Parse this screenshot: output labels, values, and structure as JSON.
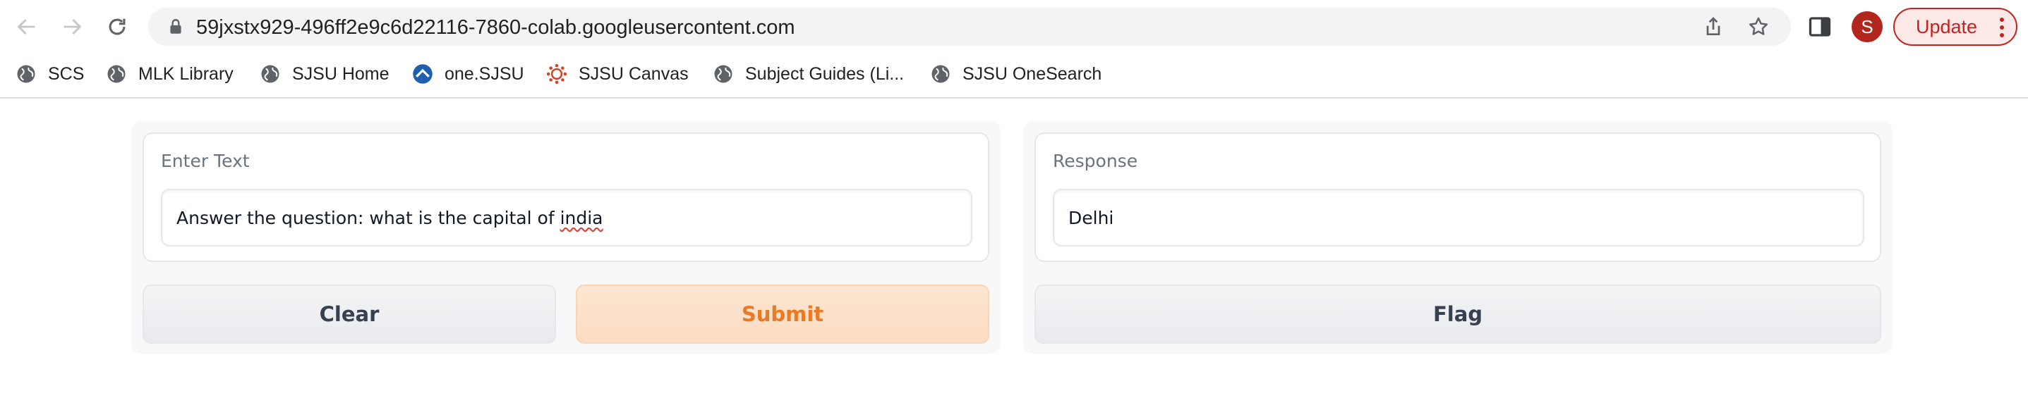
{
  "browser": {
    "url": "59jxstx929-496ff2e9c6d22116-7860-colab.googleusercontent.com",
    "profile_initial": "S",
    "update_label": "Update",
    "colors": {
      "update_accent": "#c5221f",
      "avatar": "#b3261e"
    }
  },
  "bookmarks": [
    {
      "label": "SCS",
      "icon": "globe-icon"
    },
    {
      "label": "MLK Library",
      "icon": "globe-icon"
    },
    {
      "label": "SJSU Home",
      "icon": "globe-icon"
    },
    {
      "label": "one.SJSU",
      "icon": "one-sjsu-icon"
    },
    {
      "label": "SJSU Canvas",
      "icon": "canvas-icon"
    },
    {
      "label": "Subject Guides (Li...",
      "icon": "globe-icon"
    },
    {
      "label": "SJSU OneSearch",
      "icon": "globe-icon"
    }
  ],
  "app": {
    "input": {
      "label": "Enter Text",
      "value_prefix": "Answer the question: what is the capital of ",
      "value_flagged_word": "india"
    },
    "output": {
      "label": "Response",
      "value": "Delhi"
    },
    "buttons": {
      "clear": "Clear",
      "submit": "Submit",
      "flag": "Flag"
    },
    "colors": {
      "primary": "#ea7a24",
      "primary_bg": "#fbdcc3"
    }
  }
}
